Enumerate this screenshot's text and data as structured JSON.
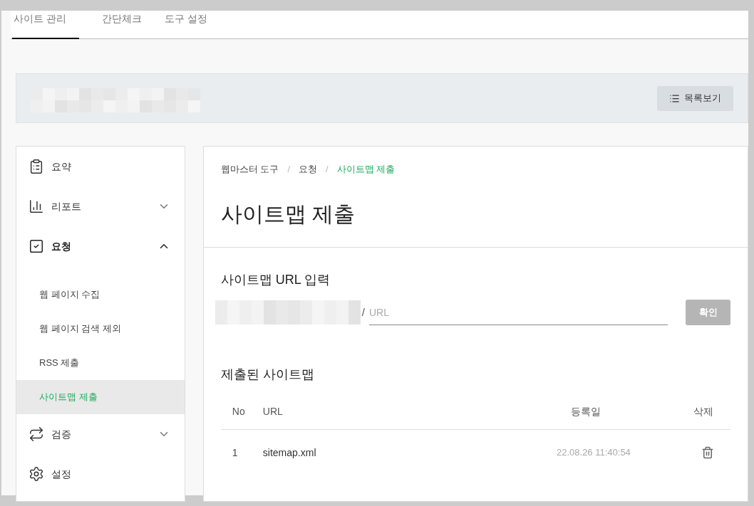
{
  "tabs": [
    {
      "label": "사이트 관리",
      "selected": true
    },
    {
      "label": "간단체크",
      "selected": false
    },
    {
      "label": "도구 설정",
      "selected": false
    }
  ],
  "site_header": {
    "list_button": "목록보기"
  },
  "sidebar": {
    "items": [
      {
        "label": "요약"
      },
      {
        "label": "리포트",
        "expanded": false
      },
      {
        "label": "요청",
        "expanded": true,
        "children": [
          {
            "label": "웹 페이지 수집",
            "selected": false
          },
          {
            "label": "웹 페이지 검색 제외",
            "selected": false
          },
          {
            "label": "RSS 제출",
            "selected": false
          },
          {
            "label": "사이트맵 제출",
            "selected": true
          }
        ]
      },
      {
        "label": "검증",
        "expanded": false
      },
      {
        "label": "설정"
      }
    ]
  },
  "breadcrumb": [
    {
      "kind": "link",
      "text": "웹마스터 도구"
    },
    {
      "kind": "separator",
      "text": "/"
    },
    {
      "kind": "link",
      "text": "요청"
    },
    {
      "kind": "separator",
      "text": "/"
    },
    {
      "kind": "current",
      "text": "사이트맵 제출"
    }
  ],
  "page_title": "사이트맵 제출",
  "url_input": {
    "heading": "사이트맵 URL 입력",
    "prefix_end": "/",
    "placeholder": "URL",
    "submit": "확인"
  },
  "submitted": {
    "heading": "제출된 사이트맵",
    "columns": [
      "No",
      "URL",
      "등록일",
      "삭제"
    ],
    "rows": [
      {
        "no": "1",
        "url": "sitemap.xml",
        "date": "22.08.26 11:40:54"
      }
    ]
  }
}
